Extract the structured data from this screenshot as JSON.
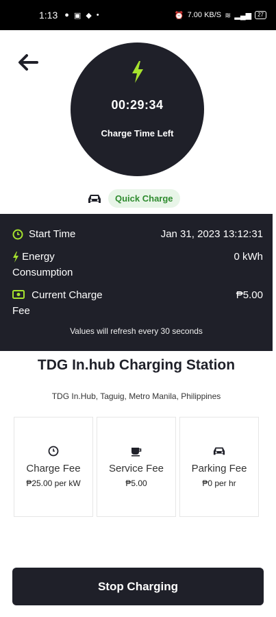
{
  "status_bar": {
    "time": "1:13",
    "speed": "7.00 KB/S",
    "battery": "27"
  },
  "timer": {
    "value": "00:29:34",
    "label": "Charge Time Left"
  },
  "charge_type": "Quick Charge",
  "session": {
    "start_time_label": "Start Time",
    "start_time_value": "Jan 31, 2023 13:12:31",
    "energy_label_line1": "Energy",
    "energy_label_line2": "Consumption",
    "energy_value": "0 kWh",
    "fee_label_line1": "Current Charge",
    "fee_label_line2": "Fee",
    "fee_value": "₱5.00",
    "refresh_note": "Values will refresh every 30 seconds"
  },
  "station": {
    "name": "TDG In.hub Charging Station",
    "address": "TDG In.Hub, Taguig, Metro Manila, Philippines"
  },
  "fees": [
    {
      "icon": "clock-icon",
      "title": "Charge Fee",
      "value": "₱25.00 per kW"
    },
    {
      "icon": "coffee-icon",
      "title": "Service Fee",
      "value": "₱5.00"
    },
    {
      "icon": "car-icon",
      "title": "Parking Fee",
      "value": "₱0 per hr"
    }
  ],
  "actions": {
    "stop_label": "Stop Charging"
  },
  "colors": {
    "dark": "#1f2029",
    "accent_green": "#a6e22e",
    "pill_bg": "#e8f5e8",
    "pill_text": "#2e8b2e"
  }
}
